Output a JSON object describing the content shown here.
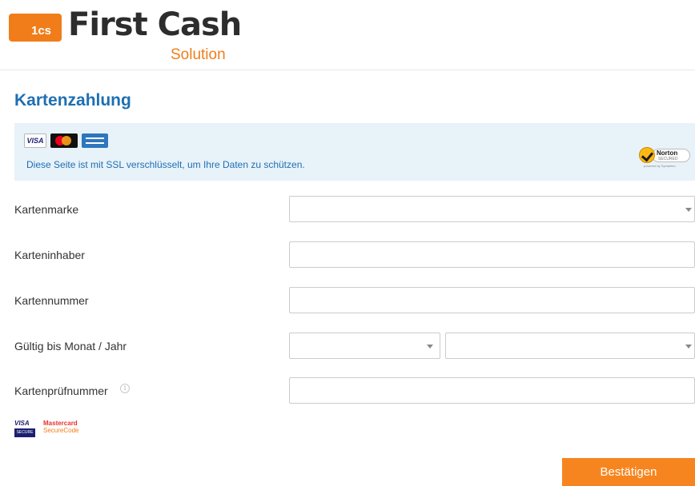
{
  "header": {
    "logo_badge": "1cs",
    "logo_text": "First Cash",
    "logo_sub": "Solution"
  },
  "page": {
    "title": "Kartenzahlung"
  },
  "ssl_notice": {
    "card_visa": "VISA",
    "text": "Diese Seite ist mit SSL verschlüsselt, um Ihre Daten zu schützen.",
    "norton_name": "Norton",
    "norton_secured": "SECURED",
    "norton_by": "powered by Symantec"
  },
  "form": {
    "card_brand": {
      "label": "Kartenmarke",
      "value": ""
    },
    "card_holder": {
      "label": "Karteninhaber",
      "value": ""
    },
    "card_number": {
      "label": "Kartennummer",
      "value": ""
    },
    "expiry": {
      "label": "Gültig bis Monat / Jahr",
      "month": "",
      "year": ""
    },
    "cvc": {
      "label": "Kartenprüfnummer",
      "info_icon": "i",
      "value": ""
    }
  },
  "security_logos": {
    "visa_top": "VISA",
    "visa_bottom": "SECURE",
    "mastercard_line1": "Mastercard",
    "mastercard_line2": "SecureCode"
  },
  "actions": {
    "submit_label": "Bestätigen"
  },
  "colors": {
    "brand_orange": "#f07d19",
    "link_blue": "#1e6fb2",
    "notice_bg": "#e8f2f9",
    "button": "#f7851f"
  }
}
